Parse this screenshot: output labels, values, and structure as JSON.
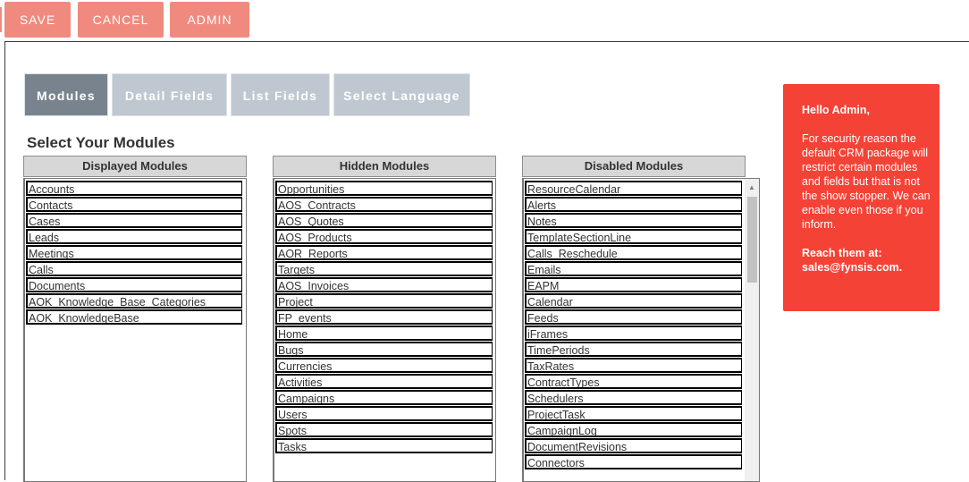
{
  "toolbar": {
    "save_label": "SAVE",
    "cancel_label": "CANCEL",
    "admin_label": "ADMIN"
  },
  "tabs": [
    {
      "label": "Modules",
      "active": true
    },
    {
      "label": "Detail Fields",
      "active": false
    },
    {
      "label": "List Fields",
      "active": false
    },
    {
      "label": "Select Language",
      "active": false
    }
  ],
  "section_title": "Select Your Modules",
  "columns": {
    "displayed": {
      "header": "Displayed Modules",
      "items": [
        "Accounts",
        "Contacts",
        "Cases",
        "Leads",
        "Meetings",
        "Calls",
        "Documents",
        "AOK_Knowledge_Base_Categories",
        "AOK_KnowledgeBase"
      ]
    },
    "hidden": {
      "header": "Hidden Modules",
      "items": [
        "Opportunities",
        "AOS_Contracts",
        "AOS_Quotes",
        "AOS_Products",
        "AOR_Reports",
        "Targets",
        "AOS_Invoices",
        "Project",
        "FP_events",
        "Home",
        "Bugs",
        "Currencies",
        "Activities",
        "Campaigns",
        "Users",
        "Spots",
        "Tasks"
      ]
    },
    "disabled": {
      "header": "Disabled Modules",
      "items": [
        "ResourceCalendar",
        "Alerts",
        "Notes",
        "TemplateSectionLine",
        "Calls_Reschedule",
        "Emails",
        "EAPM",
        "Calendar",
        "Feeds",
        "iFrames",
        "TimePeriods",
        "TaxRates",
        "ContractTypes",
        "Schedulers",
        "ProjectTask",
        "CampaignLog",
        "DocumentRevisions",
        "Connectors"
      ]
    }
  },
  "info_box": {
    "greeting": "Hello Admin,",
    "message": "For security reason the default CRM package will restrict certain modules and fields but that is not the show stopper. We can enable even those if you inform.",
    "reach_label": "Reach them at:",
    "email": "sales@fynsis.com."
  },
  "colors": {
    "toolbar_button": "#f08a7e",
    "tab_active": "#78838e",
    "tab_inactive": "#bfc8d1",
    "info_box": "#f44336"
  }
}
